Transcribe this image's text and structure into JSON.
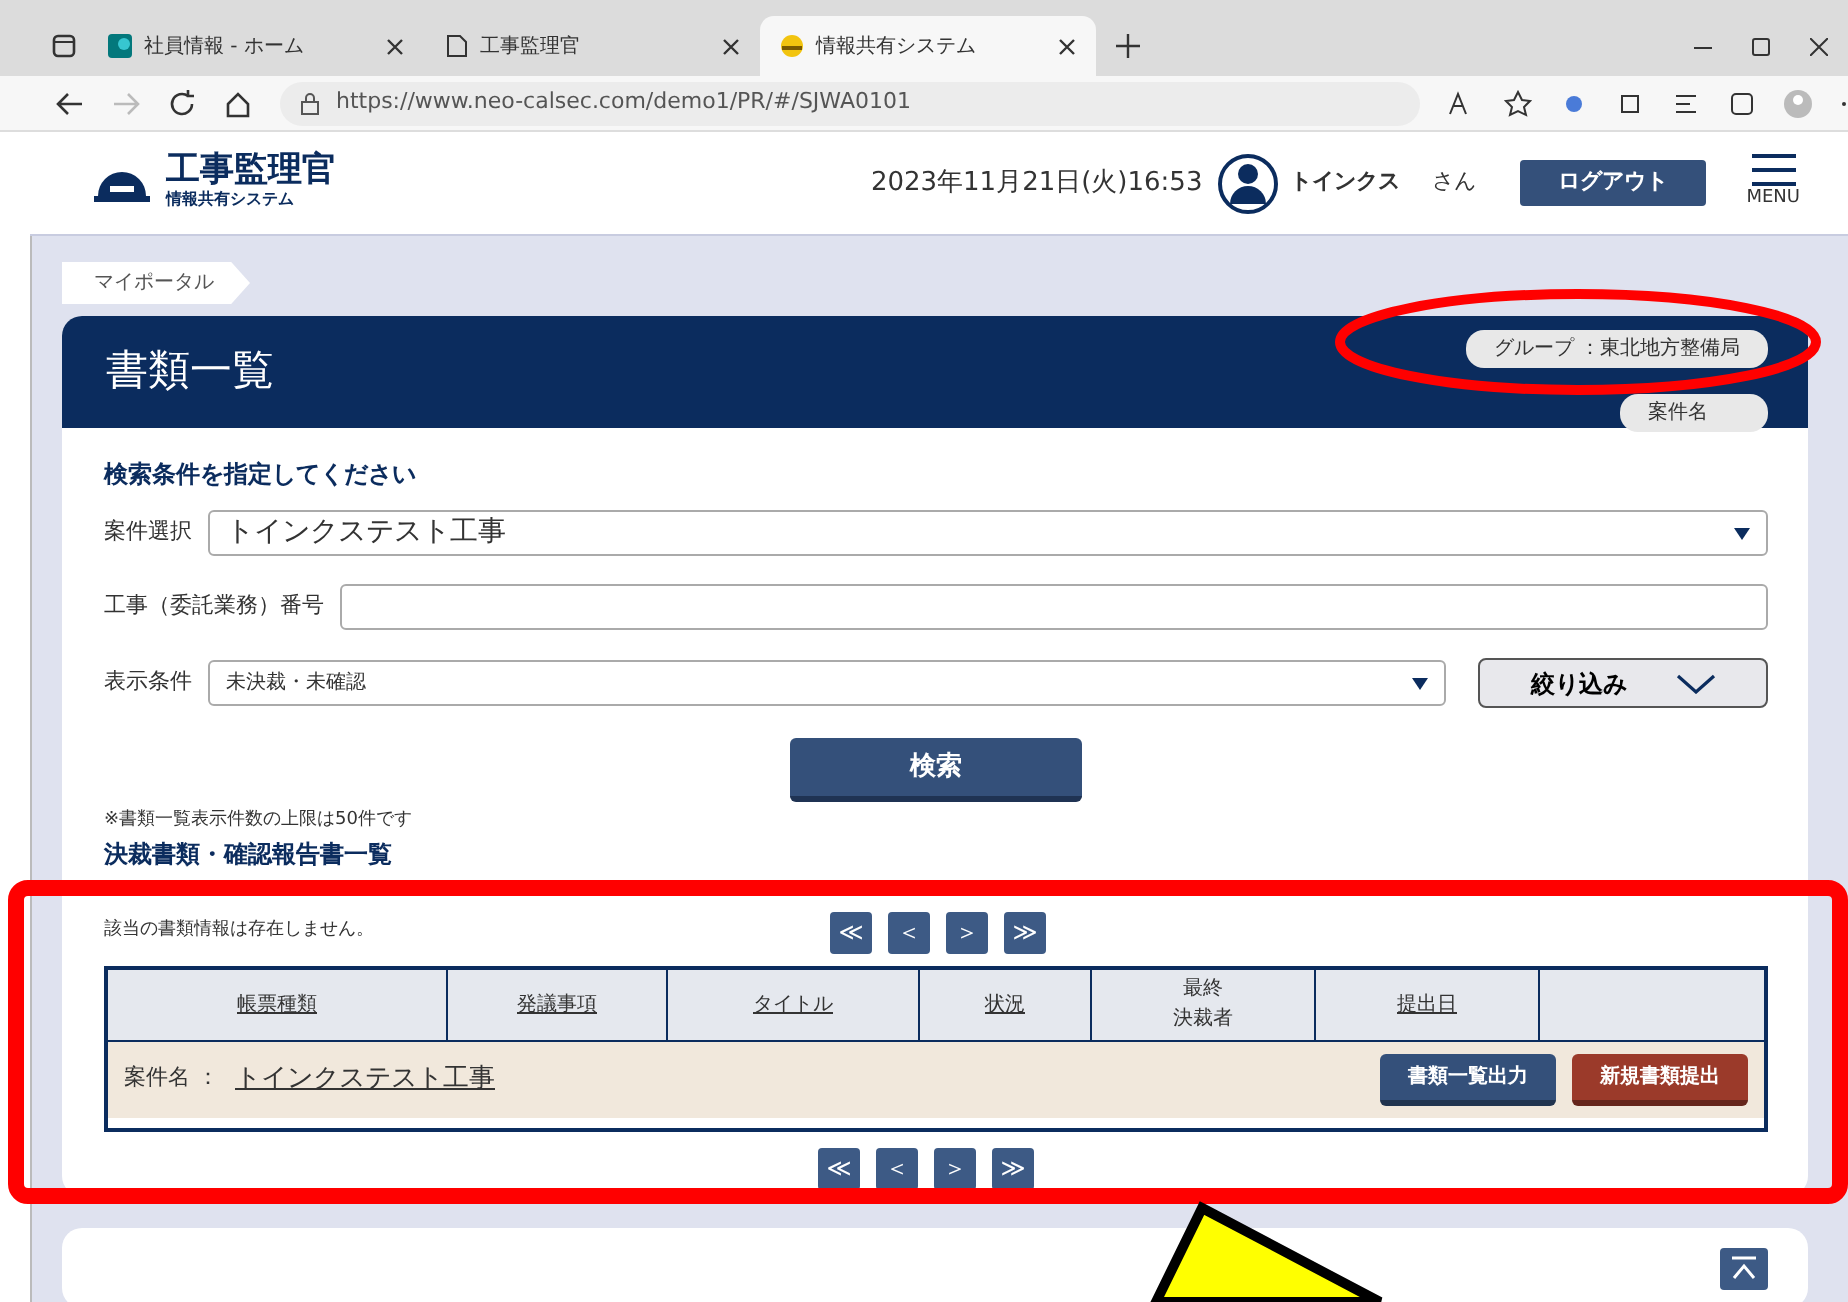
{
  "browser": {
    "tabs": [
      {
        "title": "社員情報 - ホーム",
        "kind": "sharepoint",
        "selected": false
      },
      {
        "title": "工事監理官",
        "kind": "page",
        "selected": false
      },
      {
        "title": "情報共有システム",
        "kind": "helmet",
        "selected": true
      }
    ],
    "address": "https://www.neo-calsec.com/demo1/PR/#/SJWA0101"
  },
  "header": {
    "logo_title": "工事監理官",
    "logo_subtitle": "情報共有システム",
    "datetime": "2023年11月21日(火)16:53",
    "user": "トインクス",
    "honorific": "さん",
    "logout": "ログアウト",
    "menu": "MENU"
  },
  "breadcrumb": "マイポータル",
  "panel": {
    "title": "書類一覧",
    "group_badge": "グループ ：東北地方整備局",
    "case_badge": "案件名"
  },
  "search": {
    "heading": "検索条件を指定してください",
    "fields": [
      {
        "label": "案件選択",
        "kind": "select",
        "value": "トインクステスト工事"
      },
      {
        "label": "工事（委託業務）番号",
        "kind": "input"
      },
      {
        "label": "表示条件",
        "kind": "select-filter",
        "value": "未決裁・未確認",
        "filter": "絞り込み"
      }
    ],
    "button": "検索"
  },
  "note": "※書類一覧表示件数の上限は50件です",
  "list_title": "決裁書類・確認報告書一覧",
  "message": "該当の書類情報は存在しません。",
  "pager": [
    "≪",
    "＜",
    "＞",
    "≫"
  ],
  "table": {
    "columns": [
      {
        "lines": [
          "帳票種類"
        ]
      },
      {
        "lines": [
          "発議事項"
        ]
      },
      {
        "lines": [
          "タイトル"
        ]
      },
      {
        "lines": [
          "状況"
        ]
      },
      {
        "lines": [
          "最終",
          "決裁者"
        ]
      },
      {
        "lines": [
          "提出日"
        ]
      }
    ],
    "group": {
      "label": "案件名 ：",
      "link": "トインクステスト工事",
      "buttons": [
        {
          "label": "書類一覧出力",
          "kind": "primary"
        },
        {
          "label": "新規書類提出",
          "kind": "danger"
        }
      ]
    }
  },
  "pager_bottom": [
    "≪",
    "＜",
    "＞",
    "≫"
  ],
  "annotations": [
    {
      "kind": "ellipse"
    },
    {
      "kind": "rect"
    },
    {
      "kind": "arrow"
    }
  ]
}
